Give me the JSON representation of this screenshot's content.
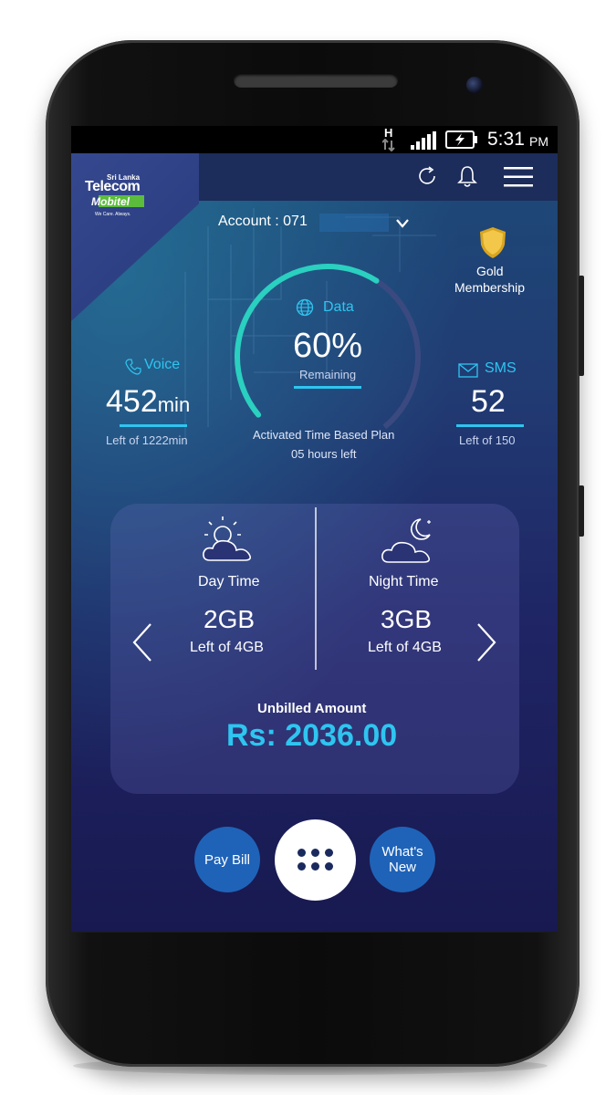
{
  "status_bar": {
    "network": "H",
    "time": "5:31",
    "ampm": "PM"
  },
  "logo": {
    "line1": "Sri Lanka",
    "line2": "Telecom",
    "line3": "Mobitel",
    "tagline": "We Care. Always."
  },
  "header": {
    "refresh_icon": "refresh-icon",
    "bell_icon": "bell-icon",
    "menu_icon": "hamburger-icon"
  },
  "account": {
    "label": "Account : 071",
    "dropdown_icon": "chevron-down-icon"
  },
  "membership": {
    "line1": "Gold",
    "line2": "Membership",
    "badge_color": "#d8a521"
  },
  "data": {
    "label": "Data",
    "percent": "60%",
    "percent_value": 0.6,
    "remaining_label": "Remaining",
    "plan_line1": "Activated Time Based Plan",
    "plan_line2": "05 hours left"
  },
  "voice": {
    "label": "Voice",
    "value": "452",
    "unit": "min",
    "sub": "Left of 1222min"
  },
  "sms": {
    "label": "SMS",
    "value": "52",
    "sub": "Left of 150"
  },
  "daytime": {
    "label": "Day Time",
    "value": "2GB",
    "sub": "Left of 4GB"
  },
  "nighttime": {
    "label": "Night Time",
    "value": "3GB",
    "sub": "Left of 4GB"
  },
  "billing": {
    "label": "Unbilled Amount",
    "amount": "Rs: 2036.00"
  },
  "actions": {
    "pay_bill": "Pay Bill",
    "whats_new_line1": "What's",
    "whats_new_line2": "New"
  },
  "colors": {
    "accent": "#2ec5f0",
    "button": "#1f63b8"
  }
}
